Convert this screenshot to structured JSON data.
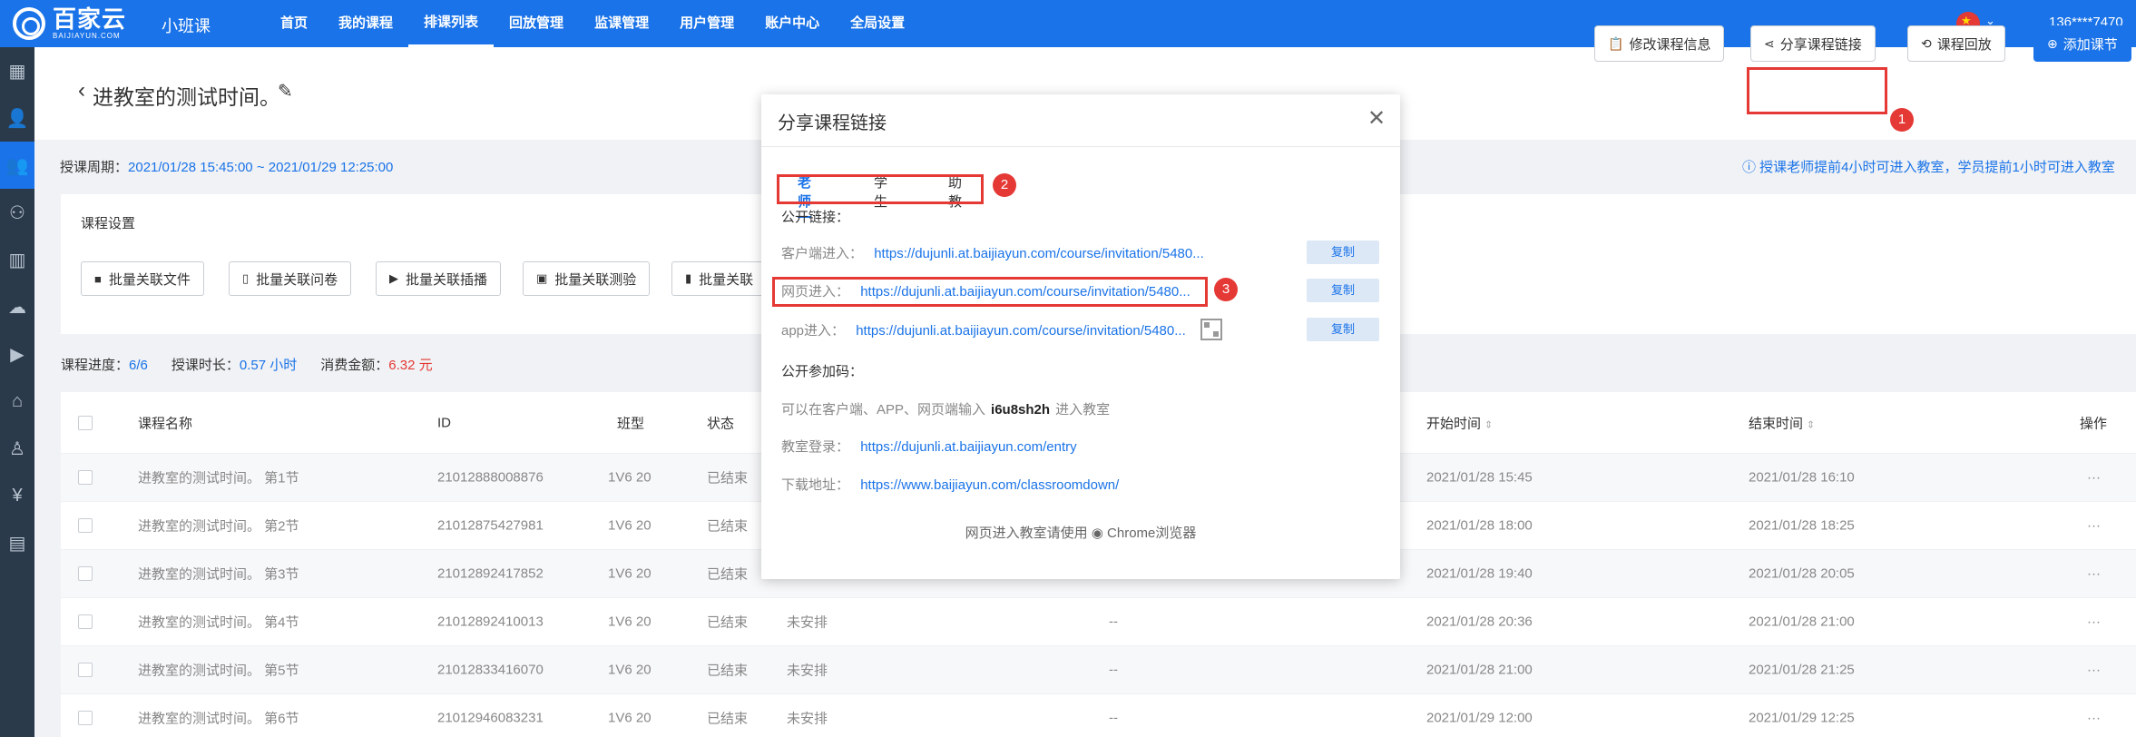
{
  "brand": {
    "logo_main": "百家云",
    "logo_sub": "BAIJIAYUN.COM",
    "product": "小班课"
  },
  "nav": {
    "items": [
      {
        "label": "首页"
      },
      {
        "label": "我的课程"
      },
      {
        "label": "排课列表",
        "active": true
      },
      {
        "label": "回放管理"
      },
      {
        "label": "监课管理"
      },
      {
        "label": "用户管理"
      },
      {
        "label": "账户中心"
      },
      {
        "label": "全局设置"
      }
    ],
    "user": "136****7470"
  },
  "header": {
    "title": "进教室的测试时间。",
    "buttons": {
      "edit_info": "修改课程信息",
      "share_link": "分享课程链接",
      "playback": "课程回放",
      "add_lesson": "添加课节"
    }
  },
  "period": {
    "label": "授课周期：",
    "value": "2021/01/28 15:45:00 ~ 2021/01/29 12:25:00"
  },
  "tip": "授课老师提前4小时可进入教室，学员提前1小时可进入教室",
  "settings": {
    "title": "课程设置",
    "buttons": [
      "批量关联文件",
      "批量关联问卷",
      "批量关联插播",
      "批量关联测验",
      "批量关联"
    ]
  },
  "progress": {
    "progress_label": "课程进度：",
    "progress_value": "6/6",
    "duration_label": "授课时长：",
    "duration_value": "0.57 小时",
    "fee_label": "消费金额：",
    "fee_value": "6.32 元"
  },
  "table": {
    "headers": {
      "name": "课程名称",
      "id": "ID",
      "class_type": "班型",
      "status": "状态",
      "start": "开始时间",
      "end": "结束时间",
      "ops": "操作"
    },
    "rows": [
      {
        "name": "进教室的测试时间。 第1节",
        "id": "21012888008876",
        "class_type": "1V6 20",
        "status": "已结束",
        "sched": "",
        "dash": "",
        "start": "2021/01/28 15:45",
        "end": "2021/01/28 16:10",
        "ops": "···"
      },
      {
        "name": "进教室的测试时间。 第2节",
        "id": "21012875427981",
        "class_type": "1V6 20",
        "status": "已结束",
        "sched": "",
        "dash": "",
        "start": "2021/01/28 18:00",
        "end": "2021/01/28 18:25",
        "ops": "···"
      },
      {
        "name": "进教室的测试时间。 第3节",
        "id": "21012892417852",
        "class_type": "1V6 20",
        "status": "已结束",
        "sched": "",
        "dash": "",
        "start": "2021/01/28 19:40",
        "end": "2021/01/28 20:05",
        "ops": "···"
      },
      {
        "name": "进教室的测试时间。 第4节",
        "id": "21012892410013",
        "class_type": "1V6 20",
        "status": "已结束",
        "sched": "未安排",
        "dash": "--",
        "start": "2021/01/28 20:36",
        "end": "2021/01/28 21:00",
        "ops": "···"
      },
      {
        "name": "进教室的测试时间。 第5节",
        "id": "21012833416070",
        "class_type": "1V6 20",
        "status": "已结束",
        "sched": "未安排",
        "dash": "--",
        "start": "2021/01/28 21:00",
        "end": "2021/01/28 21:25",
        "ops": "···"
      },
      {
        "name": "进教室的测试时间。 第6节",
        "id": "21012946083231",
        "class_type": "1V6 20",
        "status": "已结束",
        "sched": "未安排",
        "dash": "--",
        "start": "2021/01/29 12:00",
        "end": "2021/01/29 12:25",
        "ops": "···"
      }
    ]
  },
  "modal": {
    "title": "分享课程链接",
    "tabs": [
      "老师",
      "学生",
      "助教"
    ],
    "public_link_label": "公开链接：",
    "client_label": "客户端进入：",
    "client_link": "https://dujunli.at.baijiayun.com/course/invitation/5480...",
    "web_label": "网页进入：",
    "web_link": "https://dujunli.at.baijiayun.com/course/invitation/5480...",
    "app_label": "app进入：",
    "app_link": "https://dujunli.at.baijiayun.com/course/invitation/5480...",
    "copy_label": "复制",
    "code_label": "公开参加码：",
    "code_hint_pre": "可以在客户端、APP、网页端输入",
    "code": "i6u8sh2h",
    "code_hint_post": "进入教室",
    "login_label": "教室登录：",
    "login_link": "https://dujunli.at.baijiayun.com/entry",
    "download_label": "下载地址：",
    "download_link": "https://www.baijiayun.com/classroomdown/",
    "footer": "网页进入教室请使用",
    "browser": "Chrome浏览器"
  },
  "annotations": [
    "1",
    "2",
    "3"
  ],
  "colors": {
    "primary": "#1a73e8",
    "danger": "#e53935",
    "sidebar": "#2b3a4a"
  }
}
